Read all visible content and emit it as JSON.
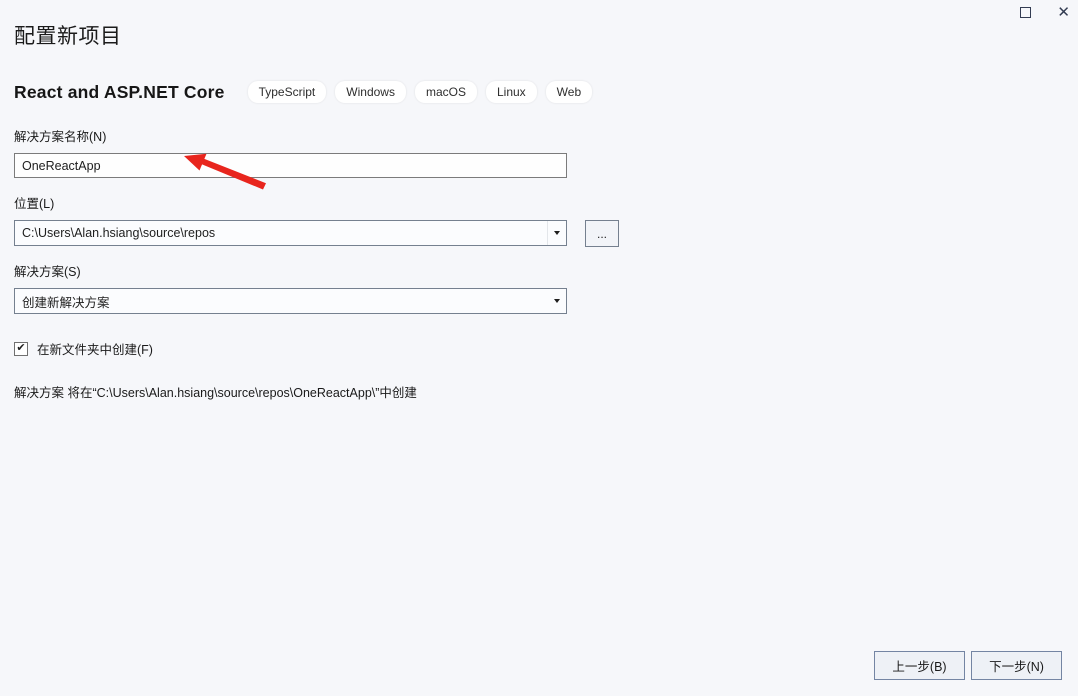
{
  "window": {
    "controls": {
      "close_glyph": "✕"
    }
  },
  "page": {
    "title": "配置新项目"
  },
  "template": {
    "name": "React and ASP.NET Core",
    "tags": [
      "TypeScript",
      "Windows",
      "macOS",
      "Linux",
      "Web"
    ]
  },
  "form": {
    "solution_name_label": "解决方案名称(N)",
    "solution_name_value": "OneReactApp",
    "location_label": "位置(L)",
    "location_value": "C:\\Users\\Alan.hsiang\\source\\repos",
    "browse_label": "...",
    "solution_label": "解决方案(S)",
    "solution_value": "创建新解决方案",
    "new_folder_label": "在新文件夹中创建(F)",
    "new_folder_checked": true,
    "checkmark_glyph": "✔",
    "summary": "解决方案 将在“C:\\Users\\Alan.hsiang\\source\\repos\\OneReactApp\\”中创建"
  },
  "footer": {
    "back_label": "上一步(B)",
    "next_label": "下一步(N)"
  },
  "colors": {
    "background": "#f6f7fa",
    "annotation_arrow_red": "#e8251d",
    "window_control": "#333c52",
    "button_border": "#7485a3"
  }
}
